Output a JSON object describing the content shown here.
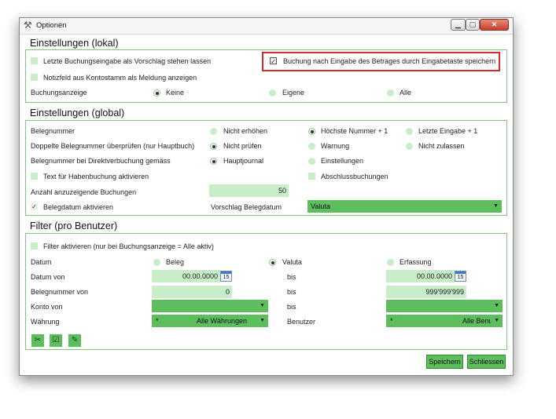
{
  "window": {
    "title": "Optionen",
    "min_glyph": "▁",
    "max_glyph": "▢",
    "close_glyph": "✕"
  },
  "lokal": {
    "header": "Einstellungen (lokal)",
    "cb_letzte": "Letzte Buchungseingabe als Vorschlag stehen lassen",
    "cb_notiz": "Notizfeld aus Kontostamm als Meldung anzeigen",
    "cb_buchung_betrag": "Buchung nach Eingabe des Betrages durch Eingabetaste speichern",
    "cb_buchung_betrag_checked": true,
    "buchungsanzeige_label": "Buchungsanzeige",
    "opt_keine": "Keine",
    "opt_eigene": "Eigene",
    "opt_alle": "Alle",
    "buchungsanzeige_selected": "Keine"
  },
  "global": {
    "header": "Einstellungen (global)",
    "belegnummer_label": "Belegnummer",
    "bn_opt1": "Nicht erhöhen",
    "bn_opt2": "Höchste Nummer + 1",
    "bn_opt3": "Letzte Eingabe + 1",
    "bn_selected": "Höchste Nummer + 1",
    "doppelte_label": "Doppelte Belegnummer überprüfen (nur Hauptbuch)",
    "dp_opt1": "Nicht prüfen",
    "dp_opt2": "Warnung",
    "dp_opt3": "Nicht zulassen",
    "dp_selected": "Nicht prüfen",
    "direkt_label": "Belegnummer bei Direktverbuchung gemäss",
    "dv_opt1": "Hauptjournal",
    "dv_opt2": "Einstellungen",
    "dv_selected": "Hauptjournal",
    "cb_haben": "Text für Habenbuchung aktivieren",
    "cb_abschluss": "Abschlussbuchungen",
    "anzahl_label": "Anzahl anzuzeigende Buchungen",
    "anzahl_value": "50",
    "cb_belegdatum": "Belegdatum aktivieren",
    "cb_belegdatum_checked": true,
    "vorschlag_label": "Vorschlag Belegdatum",
    "vorschlag_value": "Valuta"
  },
  "filter": {
    "header": "Filter (pro Benutzer)",
    "cb_filter": "Filter aktivieren (nur bei Buchungsanzeige = Alle aktiv)",
    "datum_label": "Datum",
    "d_opt1": "Beleg",
    "d_opt2": "Valuta",
    "d_opt3": "Erfassung",
    "datum_selected": "Valuta",
    "datum_von_label": "Datum von",
    "datum_von_value": "00.00.0000",
    "bis_label": "bis",
    "datum_bis_value": "00.00.0000",
    "cal_day": "15",
    "belegnr_von_label": "Belegnummer von",
    "belegnr_von_value": "0",
    "belegnr_bis_value": "999'999'999",
    "konto_von_label": "Konto von",
    "konto_von_value": "",
    "konto_bis_value": "",
    "waehrung_label": "Währung",
    "waehrung_code": "*",
    "waehrung_value": "Alle Währungen",
    "benutzer_label": "Benutzer",
    "benutzer_code": "*",
    "benutzer_value": "Alle Benutzer"
  },
  "buttons": {
    "save": "Speichern",
    "close": "Schliessen"
  }
}
